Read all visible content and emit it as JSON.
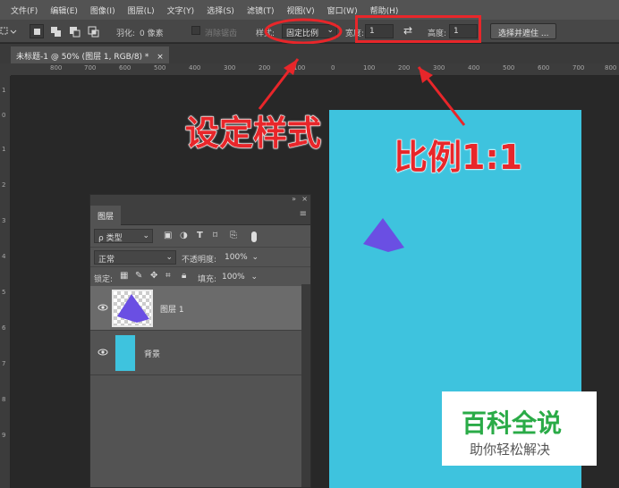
{
  "menu": [
    "文件(F)",
    "编辑(E)",
    "图像(I)",
    "图层(L)",
    "文字(Y)",
    "选择(S)",
    "滤镜(T)",
    "视图(V)",
    "窗口(W)",
    "帮助(H)"
  ],
  "options": {
    "feather_label": "羽化:",
    "feather_value": "0 像素",
    "antialias_label": "消除锯齿",
    "style_label": "样式:",
    "style_value": "固定比例",
    "width_label": "宽度:",
    "width_value": "1",
    "swap_icon": "⇄",
    "height_label": "高度:",
    "height_value": "1",
    "select_mask_button": "选择并遮住 ..."
  },
  "document": {
    "tab_title": "未标题-1 @ 50% (图层 1, RGB/8) *",
    "close_icon": "×",
    "canvas_color": "#3ec3de",
    "shape_color": "#6a4fe3"
  },
  "ruler": {
    "h_labels": [
      "800",
      "700",
      "600",
      "500",
      "400",
      "300",
      "200",
      "100",
      "0",
      "100",
      "200",
      "300",
      "400",
      "500",
      "600",
      "700",
      "800"
    ],
    "v_labels": [
      "1",
      "0",
      "1",
      "2",
      "3",
      "4",
      "5",
      "6",
      "7",
      "8",
      "9"
    ]
  },
  "layers_panel": {
    "tab": "图层",
    "filter_kind": "ρ 类型",
    "blend_mode": "正常",
    "opacity_label": "不透明度:",
    "opacity_value": "100%",
    "lock_label": "锁定:",
    "fill_label": "填充:",
    "fill_value": "100%",
    "layers": [
      {
        "name": "图层 1",
        "selected": true
      },
      {
        "name": "背景",
        "selected": false
      }
    ]
  },
  "annotations": {
    "set_style": "设定样式",
    "ratio": "比例1:1",
    "color": "#e8262a"
  },
  "watermark": {
    "title": "百科全说",
    "subtitle": "助你轻松解决",
    "title_color": "#2aab47"
  }
}
